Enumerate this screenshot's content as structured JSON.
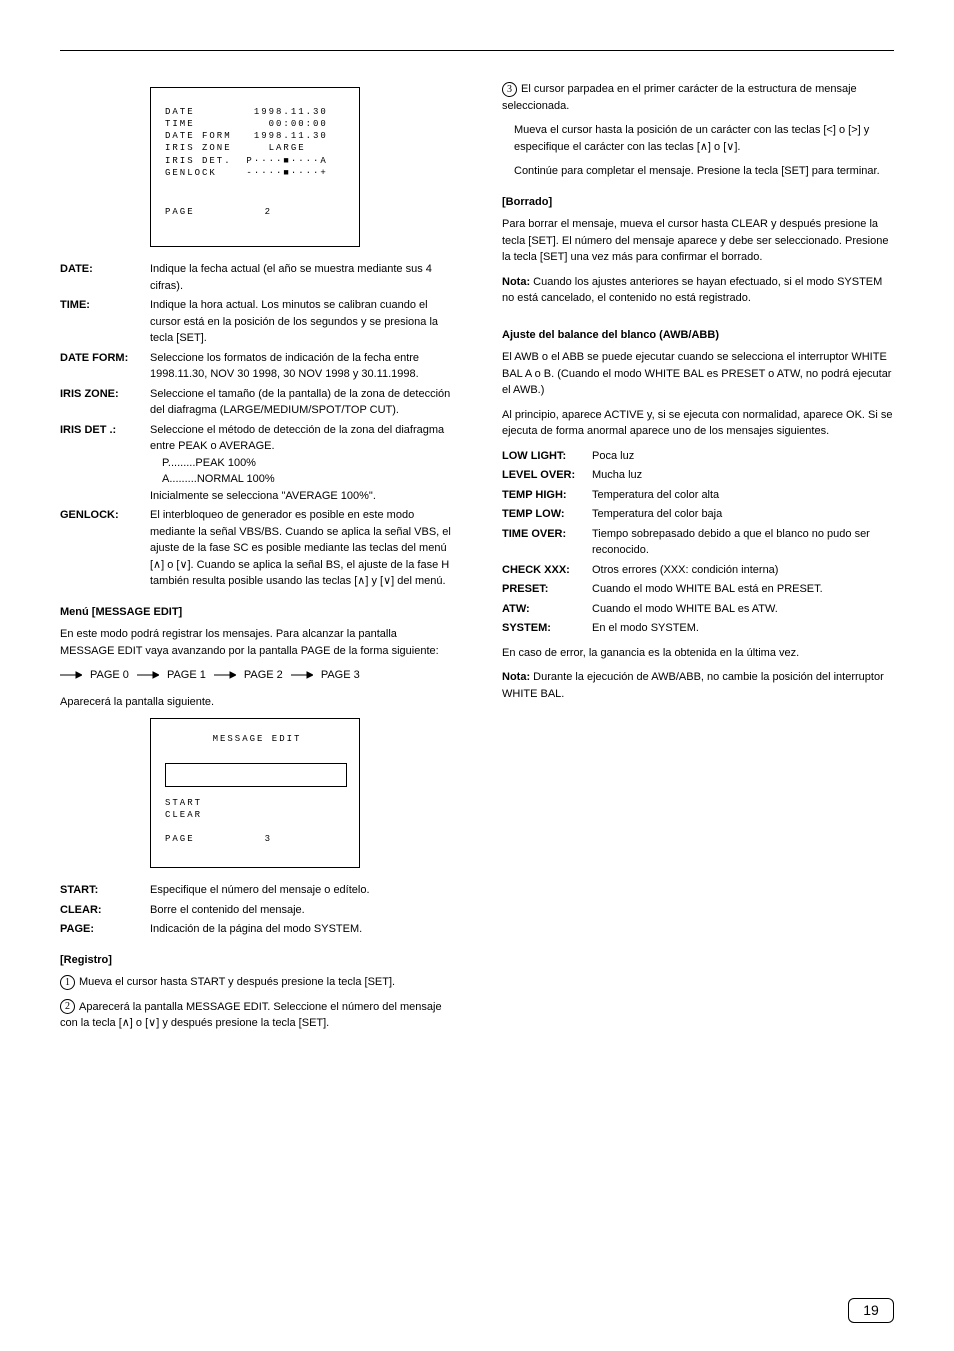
{
  "osd1": {
    "l1_label": "DATE",
    "l1_val": "1998.11.30",
    "l2_label": "TIME",
    "l2_val": "00:00:00",
    "l3_label": "DATE FORM",
    "l3_val": "1998.11.30",
    "l4_label": "IRIS ZONE",
    "l4_val": "LARGE",
    "l5_label": "IRIS DET.",
    "l5_val": "P····■····A",
    "l6_label": "GENLOCK",
    "l6_val": "-····■····+",
    "page_label": "PAGE",
    "page_val": "2"
  },
  "col_left_page2": {
    "h_date": "DATE:",
    "p_date": "Indique la fecha actual (el año se muestra mediante sus 4 cifras).",
    "h_time": "TIME:",
    "p_time": "Indique la hora actual. Los minutos se calibran cuando el cursor está en la posición de los segundos y se presiona la tecla [SET].",
    "h_dform": "DATE FORM:",
    "p_dform": "Seleccione los formatos de indicación de la fecha entre 1998.11.30, NOV 30 1998, 30 NOV 1998 y 30.11.1998.",
    "h_izone": "IRIS ZONE:",
    "p_izone": "Seleccione el tamaño (de la pantalla) de la zona de detección del diafragma (LARGE/MEDIUM/SPOT/TOP CUT).",
    "h_idet": "IRIS DET .:",
    "p_idet1": "Seleccione el método de detección de la zona del diafragma entre PEAK o AVERAGE.",
    "p_idet_p": "P.........PEAK 100%",
    "p_idet_a": "A.........NORMAL 100%",
    "p_idet2": "Inicialmente se selecciona \"AVERAGE 100%\".",
    "h_gen": "GENLOCK:",
    "p_gen": "El interbloqueo de generador es posible en este modo mediante la señal VBS/BS. Cuando se aplica la señal VBS, el ajuste de la fase SC es posible mediante las teclas del menú [∧] o [∨]. Cuando se aplica la señal BS, el ajuste de la fase H también resulta posible usando las teclas [∧] y [∨] del menú."
  },
  "col_left_msg": {
    "h": "Menú [MESSAGE EDIT]",
    "p_intro": "En este modo podrá registrar los mensajes. Para alcanzar la pantalla MESSAGE EDIT vaya avanzando por la pantalla PAGE de la forma siguiente:",
    "flow1": "PAGE 0",
    "flow2": "PAGE 1",
    "flow3": "PAGE 2",
    "flow4": "PAGE 3",
    "p_appear": "Aparecerá la pantalla siguiente."
  },
  "osd2": {
    "title": "MESSAGE EDIT",
    "start": "START",
    "clear": "CLEAR",
    "page_label": "PAGE",
    "page_val": "3"
  },
  "defs": {
    "start_h": "START:",
    "start_p": "Especifique el número del mensaje o edítelo.",
    "clear_h": "CLEAR:",
    "clear_p": "Borre el contenido del mensaje.",
    "page_h": "PAGE:",
    "page_p": "Indicación de la página del modo SYSTEM."
  },
  "left_bottom": {
    "h": "[Registro]",
    "s1_n": "1",
    "s1": "Mueva el cursor hasta START y después presione la tecla [SET].",
    "s2_n": "2",
    "s2": "Aparecerá la pantalla MESSAGE EDIT. Seleccione el número del mensaje con la tecla [∧] o [∨] y después presione la tecla [SET]."
  },
  "col_right": {
    "s3_n": "3",
    "s3_a": "El cursor parpadea en el primer carácter de la estructura de mensaje seleccionada.",
    "s3_b": "Mueva el cursor hasta la posición de un carácter con las teclas [<] o [>] y especifique el carácter con las teclas [∧] o [∨].",
    "s3_c": "Continúe para completar el mensaje. Presione la tecla [SET] para terminar.",
    "h_del": "[Borrado]",
    "p_del": "Para borrar el mensaje, mueva el cursor hasta CLEAR y después presione la tecla [SET]. El número del mensaje aparece y debe ser seleccionado. Presione la tecla [SET] una vez más para confirmar el borrado.",
    "note_h": "Nota:",
    "note_p": "Cuando los ajustes anteriores se hayan efectuado, si el modo SYSTEM no está cancelado, el contenido no está registrado.",
    "wb_h": "Ajuste del balance del blanco (AWB/ABB)",
    "wb_p1": "El AWB o el ABB se puede ejecutar cuando se selecciona el interruptor WHITE BAL A o B. (Cuando el modo WHITE BAL es PRESET o ATW, no podrá ejecutar el AWB.)",
    "wb_p2": "Al principio, aparece ACTIVE y, si se ejecuta con normalidad, aparece OK. Si se ejecuta de forma anormal aparece uno de los mensajes siguientes.",
    "defs": {
      "lowlt_h": "LOW LIGHT:",
      "lowlt_p": "Poca luz",
      "lvlov_h": "LEVEL OVER:",
      "lvlov_p": "Mucha luz",
      "thigh_h": "TEMP HIGH:",
      "thigh_p": "Temperatura del color alta",
      "tlow_h": "TEMP LOW:",
      "tlow_p": "Temperatura del color baja",
      "tout_h": "TIME OVER:",
      "tout_p": "Tiempo sobrepasado debido a que el blanco no pudo ser reconocido.",
      "chk_h": "CHECK XXX:",
      "chk_p": "Otros errores (XXX: condición interna)",
      "pre_h": "PRESET:",
      "pre_p": "Cuando el modo WHITE BAL está en PRESET.",
      "atw_h": "ATW:",
      "atw_p": "Cuando el modo WHITE BAL es ATW.",
      "syst_h": "SYSTEM:",
      "syst_p": "En el modo SYSTEM."
    },
    "wb_p3": "En caso de error, la ganancia es la obtenida en la última vez.",
    "wb_note_h": "Nota:",
    "wb_note_p": "Durante la ejecución de AWB/ABB, no cambie la posición del interruptor WHITE BAL."
  },
  "page_number": "19"
}
